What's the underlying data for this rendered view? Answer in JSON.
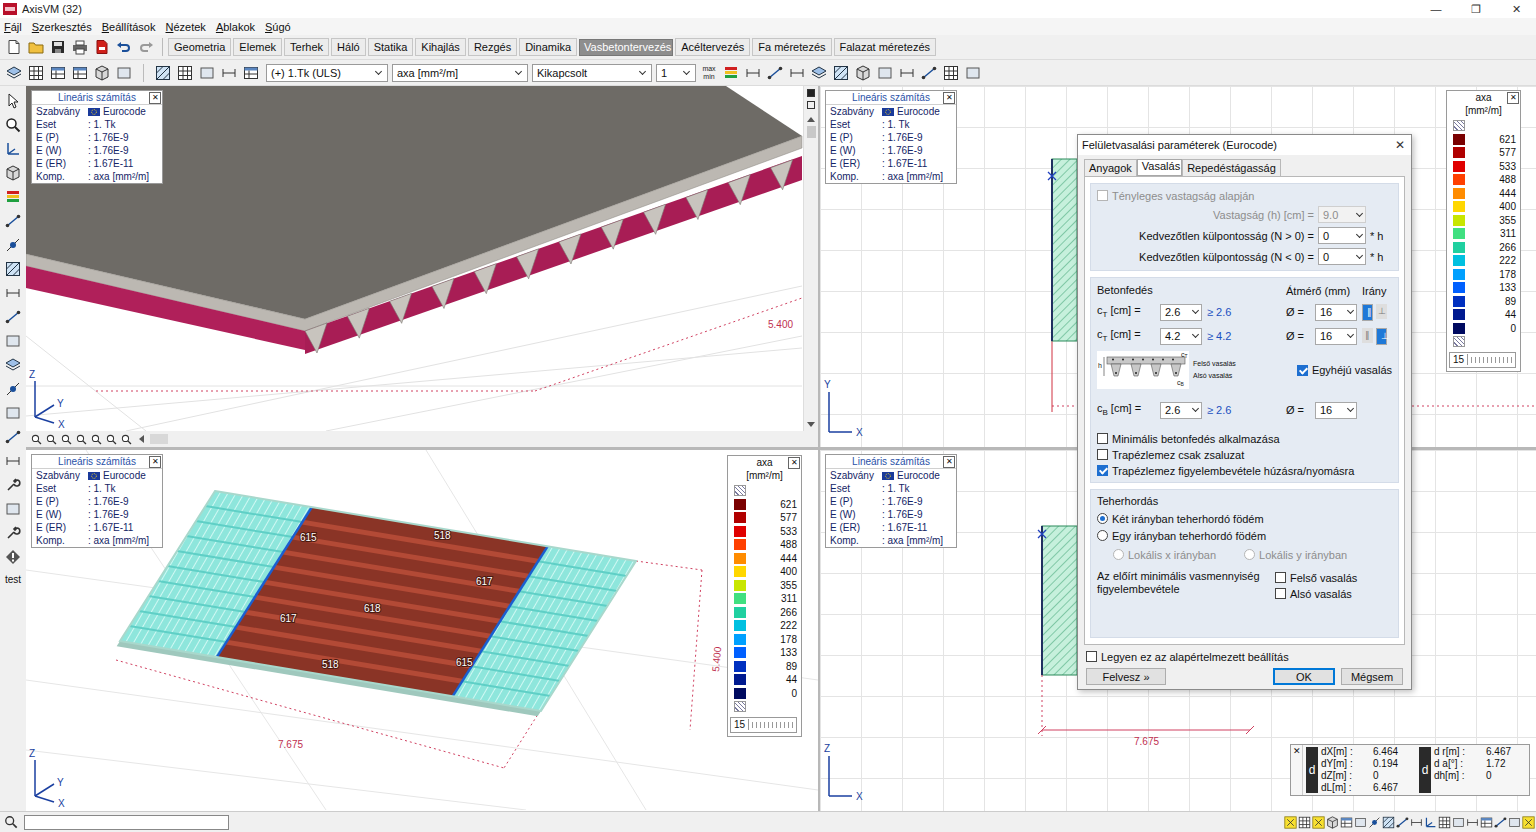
{
  "window": {
    "title": "AxisVM (32)",
    "controls": [
      "—",
      "❐",
      "✕"
    ]
  },
  "menu": [
    "Fájl",
    "Szerkesztés",
    "Beállítások",
    "Nézetek",
    "Ablakok",
    "Súgó"
  ],
  "ribbon_tabs": [
    {
      "label": "Geometria",
      "selected": false
    },
    {
      "label": "Elemek",
      "selected": false
    },
    {
      "label": "Terhek",
      "selected": false
    },
    {
      "label": "Háló",
      "selected": false
    },
    {
      "label": "Statika",
      "selected": false
    },
    {
      "label": "Kihajlás",
      "selected": false
    },
    {
      "label": "Rezgés",
      "selected": false
    },
    {
      "label": "Dinamika",
      "selected": false
    },
    {
      "label": "Vasbetontervezés",
      "selected": true
    },
    {
      "label": "Acéltervezés",
      "selected": false
    },
    {
      "label": "Fa méretezés",
      "selected": false
    },
    {
      "label": "Falazat méretezés",
      "selected": false
    }
  ],
  "toolbar": {
    "load_case": "(+) 1.Tk (ULS)",
    "component": "axa [mm²/m]",
    "mode": "Kikapcsolt",
    "count": "1",
    "minmax": [
      "max",
      "min"
    ]
  },
  "left_toolbar": {
    "label": "test"
  },
  "viewports": [
    {
      "kind": "solid-3d",
      "info": {
        "title": "Lineáris számítás",
        "close": "✕",
        "rows": [
          {
            "key": "Szabvány",
            "value": "Eurocode",
            "kind": "flag"
          },
          {
            "key": "Eset",
            "value": ": 1. Tk",
            "kind": "plain"
          },
          {
            "key": "E (P)",
            "value": ": 1.76E-9",
            "kind": "plain"
          },
          {
            "key": "E (W)",
            "value": ": 1.76E-9",
            "kind": "plain"
          },
          {
            "key": "E (ER)",
            "value": ": 1.67E-11",
            "kind": "plain"
          },
          {
            "key": "Komp.",
            "value": ": axa [mm²/m]",
            "kind": "plain"
          }
        ]
      },
      "axes": [
        "Z",
        "Y",
        "X"
      ],
      "dimensions": [
        "5.400"
      ],
      "labels": [],
      "legend": null
    },
    {
      "kind": "side-top",
      "info": {
        "title": "Lineáris számítás",
        "close": "✕",
        "rows": [
          {
            "key": "Szabvány",
            "value": "Eurocode",
            "kind": "flag"
          },
          {
            "key": "Eset",
            "value": ": 1. Tk",
            "kind": "plain"
          },
          {
            "key": "E (P)",
            "value": ": 1.76E-9",
            "kind": "plain"
          },
          {
            "key": "E (W)",
            "value": ": 1.76E-9",
            "kind": "plain"
          },
          {
            "key": "E (ER)",
            "value": ": 1.67E-11",
            "kind": "plain"
          },
          {
            "key": "Komp.",
            "value": ": axa [mm²/m]",
            "kind": "plain"
          }
        ]
      },
      "axes": [
        "Y",
        "X"
      ],
      "dimensions": [],
      "labels": [],
      "legend": {
        "title": "axa",
        "unit": "[mm²/m]",
        "close": "✕",
        "steps": "15",
        "items": [
          {
            "value": "621",
            "color": "#7a0000"
          },
          {
            "value": "577",
            "color": "#b00000"
          },
          {
            "value": "533",
            "color": "#e00000"
          },
          {
            "value": "488",
            "color": "#ff4000"
          },
          {
            "value": "444",
            "color": "#ff8c00"
          },
          {
            "value": "400",
            "color": "#ffd700"
          },
          {
            "value": "355",
            "color": "#c8e600"
          },
          {
            "value": "311",
            "color": "#40e080"
          },
          {
            "value": "266",
            "color": "#20d0a0"
          },
          {
            "value": "222",
            "color": "#00c0e0"
          },
          {
            "value": "178",
            "color": "#00a0ff"
          },
          {
            "value": "133",
            "color": "#0060ff"
          },
          {
            "value": "89",
            "color": "#0030c0"
          },
          {
            "value": "44",
            "color": "#001a90"
          },
          {
            "value": "0",
            "color": "#000a60"
          }
        ]
      }
    },
    {
      "kind": "result-3d",
      "info": {
        "title": "Lineáris számítás",
        "close": "✕",
        "rows": [
          {
            "key": "Szabvány",
            "value": "Eurocode",
            "kind": "flag"
          },
          {
            "key": "Eset",
            "value": ": 1. Tk",
            "kind": "plain"
          },
          {
            "key": "E (P)",
            "value": ": 1.76E-9",
            "kind": "plain"
          },
          {
            "key": "E (W)",
            "value": ": 1.76E-9",
            "kind": "plain"
          },
          {
            "key": "E (ER)",
            "value": ": 1.67E-11",
            "kind": "plain"
          },
          {
            "key": "Komp.",
            "value": ": axa [mm²/m]",
            "kind": "plain"
          }
        ]
      },
      "axes": [
        "Z",
        "Y",
        "X"
      ],
      "dimensions": [
        "7.675",
        "5.400"
      ],
      "labels": [
        "615",
        "518",
        "617",
        "618",
        "617",
        "518",
        "615"
      ],
      "legend": {
        "title": "axa",
        "unit": "[mm²/m]",
        "close": "✕",
        "steps": "15",
        "items": [
          {
            "value": "621",
            "color": "#7a0000"
          },
          {
            "value": "577",
            "color": "#b00000"
          },
          {
            "value": "533",
            "color": "#e00000"
          },
          {
            "value": "488",
            "color": "#ff4000"
          },
          {
            "value": "444",
            "color": "#ff8c00"
          },
          {
            "value": "400",
            "color": "#ffd700"
          },
          {
            "value": "355",
            "color": "#c8e600"
          },
          {
            "value": "311",
            "color": "#40e080"
          },
          {
            "value": "266",
            "color": "#20d0a0"
          },
          {
            "value": "222",
            "color": "#00c0e0"
          },
          {
            "value": "178",
            "color": "#00a0ff"
          },
          {
            "value": "133",
            "color": "#0060ff"
          },
          {
            "value": "89",
            "color": "#0030c0"
          },
          {
            "value": "44",
            "color": "#001a90"
          },
          {
            "value": "0",
            "color": "#000a60"
          }
        ]
      }
    },
    {
      "kind": "side-front",
      "info": {
        "title": "Lineáris számítás",
        "close": "✕",
        "rows": [
          {
            "key": "Szabvány",
            "value": "Eurocode",
            "kind": "flag"
          },
          {
            "key": "Eset",
            "value": ": 1. Tk",
            "kind": "plain"
          },
          {
            "key": "E (P)",
            "value": ": 1.76E-9",
            "kind": "plain"
          },
          {
            "key": "E (W)",
            "value": ": 1.76E-9",
            "kind": "plain"
          },
          {
            "key": "E (ER)",
            "value": ": 1.67E-11",
            "kind": "plain"
          },
          {
            "key": "Komp.",
            "value": ": axa [mm²/m]",
            "kind": "plain"
          }
        ]
      },
      "axes": [
        "Z",
        "X"
      ],
      "dimensions": [
        "7.675"
      ],
      "labels": [],
      "legend": null
    }
  ],
  "dialog": {
    "title": "Felületvasalási paraméterek (Eurocode)",
    "close": "✕",
    "tabs": [
      {
        "label": "Anyagok",
        "selected": false
      },
      {
        "label": "Vasalás",
        "selected": true
      },
      {
        "label": "Repedéstágasság",
        "selected": false
      }
    ],
    "thickness_check": {
      "label": "Tényleges vastagság alapján",
      "checked": false,
      "disabled": true
    },
    "fields": [
      {
        "label": "Vastagság (h) [cm] =",
        "value": "9.0",
        "disabled": true
      },
      {
        "label": "Kedvezőtlen külpontosság (N > 0) =",
        "value": "0",
        "unit": "* h",
        "disabled": false
      },
      {
        "label": "Kedvezőtlen külpontosság (N < 0) =",
        "value": "0",
        "unit": "* h",
        "disabled": false
      }
    ],
    "cover": {
      "title": "Betonfedés",
      "diameter_header": "Átmérő (mm)",
      "direction_header": "Irány",
      "top_rows": [
        {
          "symbol": "c",
          "sub": "T",
          "unit": "[cm] =",
          "value": "2.6",
          "min": "≥ 2.6",
          "dia_label": "Ø =",
          "diameter": "16",
          "directions": [
            {
              "glyph": "∥",
              "selected": true
            },
            {
              "glyph": "⊥",
              "selected": false
            }
          ]
        },
        {
          "symbol": "c",
          "sub": "T",
          "unit": "[cm] =",
          "value": "4.2",
          "min": "≥ 4.2",
          "dia_label": "Ø =",
          "diameter": "16",
          "directions": [
            {
              "glyph": "∥",
              "selected": false
            },
            {
              "glyph": "⊥",
              "selected": true
            }
          ]
        }
      ],
      "figure": {
        "h": "h",
        "top_symbol": "c",
        "top_sub": "T",
        "bottom_symbol": "c",
        "bottom_sub": "B",
        "top_label": "Felső vasalás",
        "bottom_label": "Alsó vasalás"
      },
      "single_layer": {
        "label": "Egyhéjú vasalás",
        "checked": true
      },
      "bottom_row": {
        "symbol": "c",
        "sub": "B",
        "unit": "[cm] =",
        "value": "2.6",
        "min": "≥ 2.6",
        "dia_label": "Ø =",
        "diameter": "16"
      },
      "options": [
        {
          "label": "Minimális betonfedés alkalmazása",
          "checked": false
        },
        {
          "label": "Trapézlemez csak zsaluzat",
          "checked": false
        },
        {
          "label": "Trapézlemez figyelembevétele húzásra/nyomásra",
          "checked": true
        }
      ]
    },
    "load_bearing": {
      "title": "Teherhordás",
      "modes": [
        {
          "label": "Két irányban teherhordó födém",
          "selected": true
        },
        {
          "label": "Egy irányban teherhordó födém",
          "selected": false
        }
      ],
      "local_dirs": [
        {
          "label": "Lokális x irányban",
          "selected": false,
          "disabled": true
        },
        {
          "label": "Lokális y irányban",
          "selected": false,
          "disabled": true
        }
      ],
      "min_reinf_label": "Az előírt minimális vasmennyiség figyelembevétele",
      "min_reinf": [
        {
          "label": "Felső vasalás",
          "checked": false
        },
        {
          "label": "Alsó vasalás",
          "checked": false
        }
      ]
    },
    "default_check": {
      "label": "Legyen ez az alapértelmezett beállítás",
      "checked": false
    },
    "buttons": [
      {
        "label": "Felvesz »",
        "kind": "secondary"
      },
      {
        "label": "OK",
        "kind": "default"
      },
      {
        "label": "Mégsem",
        "kind": "normal"
      }
    ]
  },
  "coordinates": {
    "close": "✕",
    "groups": [
      {
        "badge": "d",
        "rows": [
          {
            "key": "dX[m] :",
            "value": "6.464"
          },
          {
            "key": "dY[m] :",
            "value": "0.194"
          },
          {
            "key": "dZ[m] :",
            "value": "0"
          },
          {
            "key": "dL[m] :",
            "value": "6.467"
          }
        ]
      },
      {
        "badge": "d",
        "rows": [
          {
            "key": "d r[m] :",
            "value": "6.467"
          },
          {
            "key": "d a[°] :",
            "value": "1.72"
          },
          {
            "key": "dh[m] :",
            "value": "0"
          }
        ]
      }
    ]
  }
}
